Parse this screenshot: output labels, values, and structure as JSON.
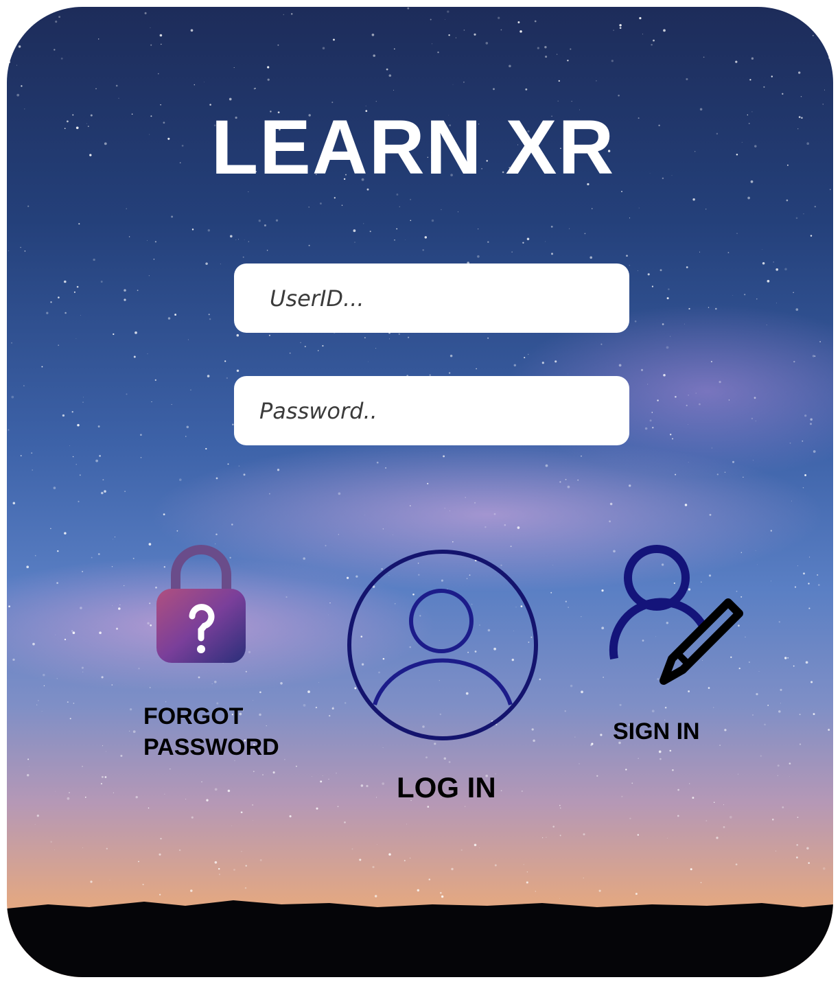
{
  "app": {
    "title": "LEARN XR"
  },
  "login_form": {
    "userid_placeholder": "UserID...",
    "password_placeholder": "Password.."
  },
  "actions": {
    "forgot_password": {
      "label_line1": "FORGOT",
      "label_line2": "PASSWORD",
      "icon": "lock-question-icon"
    },
    "log_in": {
      "label": "LOG IN",
      "icon": "user-circle-icon"
    },
    "sign_in": {
      "label": "SIGN IN",
      "icon": "user-edit-icon"
    }
  },
  "colors": {
    "title": "#ffffff",
    "field_bg": "#ffffff",
    "icon_stroke": "#1a1a7a",
    "label": "#000000"
  }
}
